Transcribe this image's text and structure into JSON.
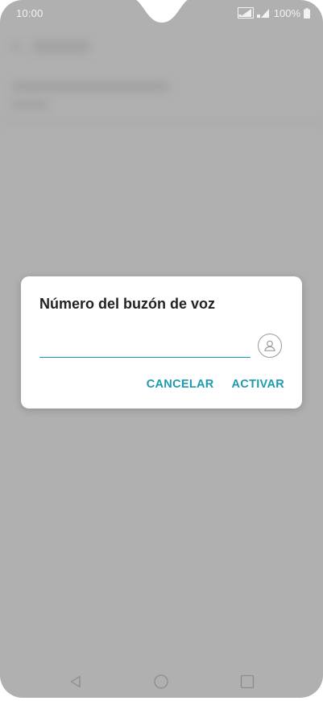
{
  "status_bar": {
    "time": "10:00",
    "battery_percent": "100%",
    "icons": [
      "signal-icon",
      "signal-icon",
      "battery-icon"
    ]
  },
  "dialog": {
    "title": "Número del buzón de voz",
    "input": {
      "value": "",
      "placeholder": ""
    },
    "contact_icon": "contact-icon",
    "buttons": {
      "cancel": "CANCELAR",
      "activate": "ACTIVAR"
    }
  },
  "nav_bar": {
    "icons": [
      "back-icon",
      "home-icon",
      "recents-icon"
    ]
  },
  "colors": {
    "accent": "#1e9ab0",
    "scrim": "#b0b0b0",
    "dialog_bg": "#ffffff",
    "title_text": "#222222"
  }
}
